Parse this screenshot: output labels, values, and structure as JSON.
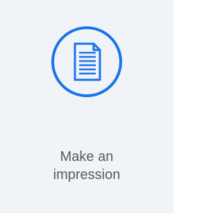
{
  "tile": {
    "icon": "document-icon",
    "caption_line1": "Make an",
    "caption_line2": "impression",
    "accent_color": "#1a73e8",
    "background_color": "#f0f3f8"
  }
}
